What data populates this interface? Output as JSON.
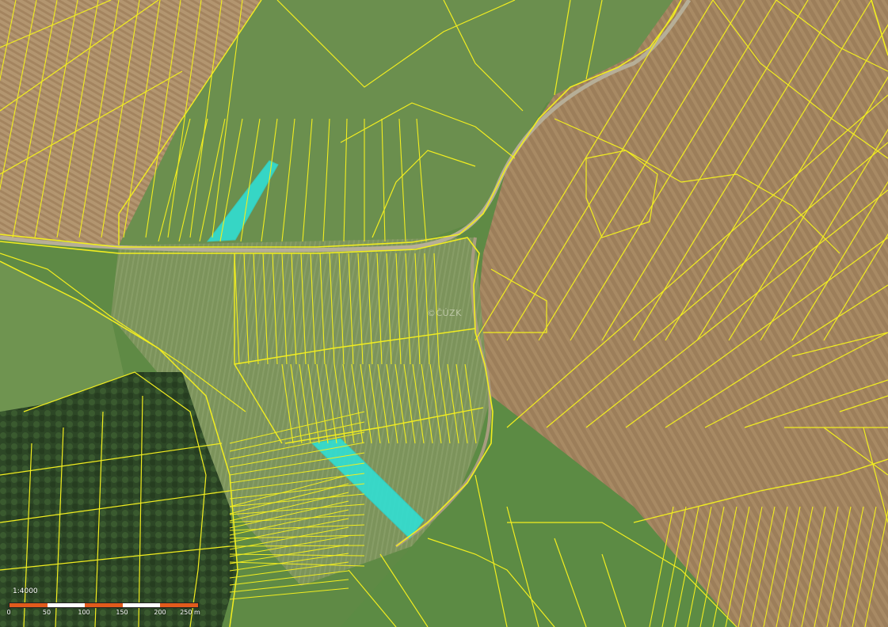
{
  "map": {
    "watermark": "©ČÚZK",
    "parcel_line_color": "#f2ee1f",
    "highlight_color": "#2fe0d6",
    "terrain": {
      "grass": "#5f8a45",
      "meadow": "#7a9a5c",
      "field_brown": "#9c7e5a",
      "field_tan": "#b39670",
      "forest": "#2f4a27"
    }
  },
  "scale": {
    "title": "1:4000",
    "unit": "m",
    "ticks": [
      "0",
      "50",
      "100",
      "150",
      "200",
      "250 m"
    ],
    "segment_colors": [
      "#e25b1c",
      "#ffffff"
    ]
  }
}
